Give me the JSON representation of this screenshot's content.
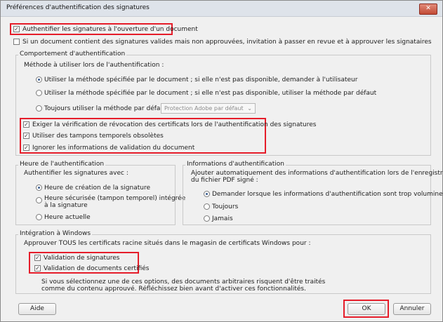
{
  "window": {
    "title": "Préférences d'authentification des signatures",
    "close_glyph": "✕"
  },
  "options": {
    "verify_on_open": "Authentifier les signatures à l'ouverture d'un document",
    "unapproved_notice": "Si un document contient des signatures valides mais non approuvées, invitation à passer en revue et à approuver les signataires"
  },
  "behavior": {
    "legend": "Comportement d'authentification",
    "method_label": "Méthode à utiliser lors de l'authentification :",
    "radio1": "Utiliser la méthode spécifiée par le document ; si elle n'est pas disponible, demander à l'utilisateur",
    "radio2": "Utiliser la méthode spécifiée par le document ; si elle n'est pas disponible, utiliser la méthode par défaut",
    "radio3": "Toujours utiliser la méthode par défaut :",
    "default_method": "Protection Adobe par défaut",
    "check1": "Exiger la vérification de révocation des certificats lors de l'authentification des signatures",
    "check2": "Utiliser des tampons temporels obsolètes",
    "check3": "Ignorer les informations de validation du document"
  },
  "time": {
    "legend": "Heure de l'authentification",
    "label": "Authentifier les signatures avec :",
    "opt1": "Heure de création de la signature",
    "opt2_line1": "Heure sécurisée (tampon temporel) intégrée",
    "opt2_line2": "à la signature",
    "opt3": "Heure actuelle"
  },
  "info": {
    "legend": "Informations d'authentification",
    "label_line1": "Ajouter automatiquement des informations d'authentification lors de l'enregistrement",
    "label_line2": "du fichier PDF signé :",
    "opt1": "Demander lorsque les informations d'authentification sont trop volumineuses",
    "opt2": "Toujours",
    "opt3": "Jamais"
  },
  "windows": {
    "legend": "Intégration à Windows",
    "label": "Approuver TOUS les certificats racine situés dans le magasin de certificats Windows pour :",
    "check1": "Validation de signatures",
    "check2": "Validation de documents certifiés",
    "warn_line1": "Si vous sélectionnez une de ces options, des documents arbitraires risquent d'être traités",
    "warn_line2": "comme du contenu approuvé. Réfléchissez bien avant d'activer ces fonctionnalités."
  },
  "buttons": {
    "help": "Aide",
    "ok": "OK",
    "cancel": "Annuler"
  },
  "glyphs": {
    "check": "✓",
    "chevron": "⌄"
  },
  "colors": {
    "highlight": "#e51d2a",
    "radio_selected": "#3d5f91"
  }
}
